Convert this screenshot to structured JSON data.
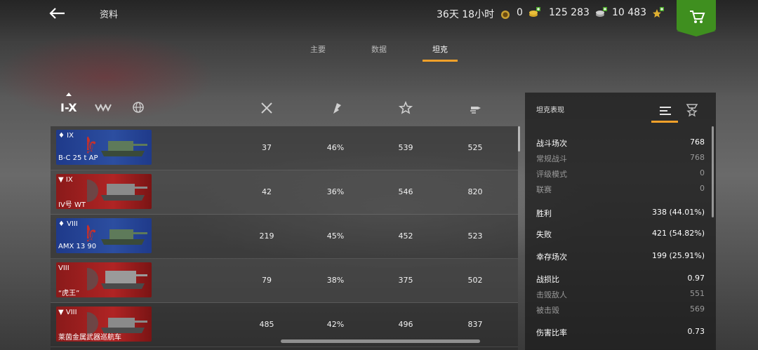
{
  "header": {
    "title": "资料",
    "premium_time": "36天 18小时",
    "gold": "0",
    "credits": "125 283",
    "free_xp": "10 483"
  },
  "tabs": [
    {
      "label": "主要"
    },
    {
      "label": "数据"
    },
    {
      "label": "坦克"
    }
  ],
  "filters": {
    "tier_label": "I-X"
  },
  "rows": [
    {
      "tier": "♦ IX",
      "name": "B-C 25 t AP",
      "nation": "fr",
      "c1": "37",
      "c2": "46%",
      "c3": "539",
      "c4": "525"
    },
    {
      "tier": "▼ IX",
      "name": "IV号 WT",
      "nation": "de",
      "c1": "42",
      "c2": "36%",
      "c3": "546",
      "c4": "820"
    },
    {
      "tier": "♦ VIII",
      "name": "AMX 13 90",
      "nation": "fr",
      "c1": "219",
      "c2": "45%",
      "c3": "452",
      "c4": "523"
    },
    {
      "tier": "VIII",
      "name": "“虎王”",
      "nation": "de",
      "c1": "79",
      "c2": "38%",
      "c3": "375",
      "c4": "502"
    },
    {
      "tier": "▼ VIII",
      "name": "莱茵金属武器巡航车",
      "nation": "de",
      "c1": "485",
      "c2": "42%",
      "c3": "496",
      "c4": "837"
    }
  ],
  "panel": {
    "title": "坦克表现",
    "stats": [
      {
        "label": "战斗场次",
        "value": "768",
        "kind": "main"
      },
      {
        "label": "常规战斗",
        "value": "768",
        "kind": "sub"
      },
      {
        "label": "评级模式",
        "value": "0",
        "kind": "sub"
      },
      {
        "label": "联赛",
        "value": "0",
        "kind": "sub"
      },
      {
        "label": "胜利",
        "value": "338 (44.01%)",
        "kind": "main"
      },
      {
        "label": "失败",
        "value": "421 (54.82%)",
        "kind": "main"
      },
      {
        "label": "幸存场次",
        "value": "199 (25.91%)",
        "kind": "main"
      },
      {
        "label": "战损比",
        "value": "0.97",
        "kind": "main"
      },
      {
        "label": "击毁敌人",
        "value": "551",
        "kind": "sub"
      },
      {
        "label": "被击毁",
        "value": "569",
        "kind": "sub"
      },
      {
        "label": "伤害比率",
        "value": "0.73",
        "kind": "main"
      }
    ]
  },
  "colors": {
    "accent": "#f0a02a",
    "shop_green": "#3f8f1f",
    "france_blue": "#1f3a8a",
    "germany_red": "#b02424"
  }
}
